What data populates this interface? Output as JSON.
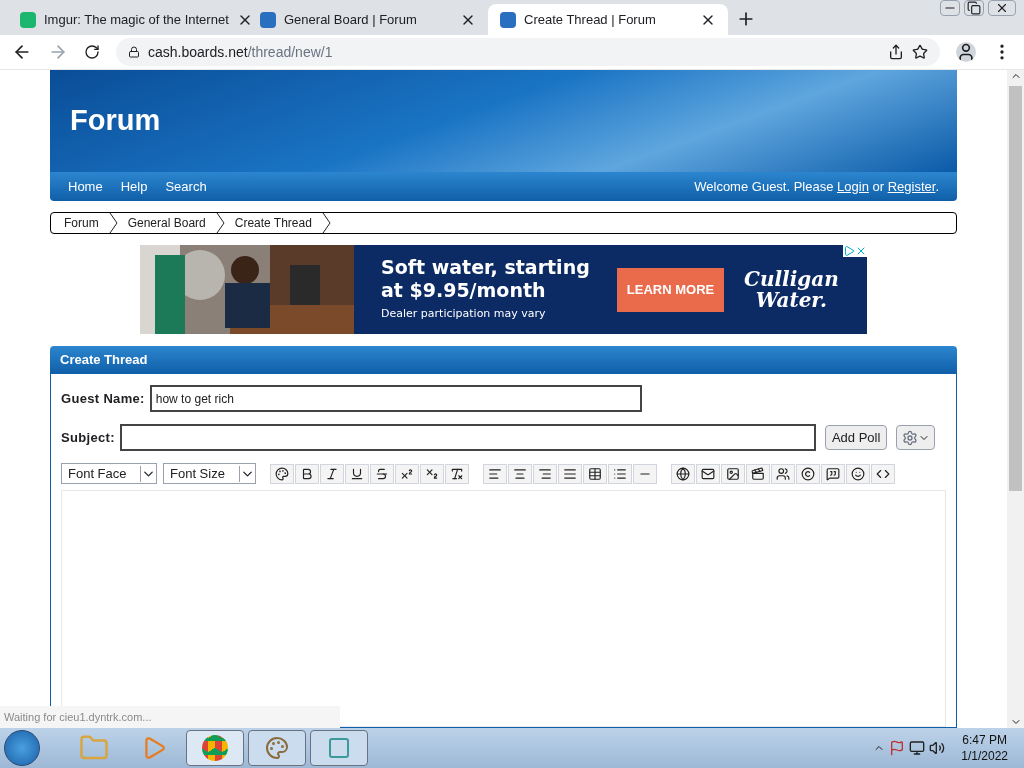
{
  "browser": {
    "tabs": [
      {
        "title": "Imgur: The magic of the Internet",
        "selected": false,
        "kind": "imgur"
      },
      {
        "title": "General Board | Forum",
        "selected": false,
        "kind": "pb"
      },
      {
        "title": "Create Thread | Forum",
        "selected": true,
        "kind": "pb"
      }
    ],
    "url_host": "cash.boards.net",
    "url_path": "/thread/new/1",
    "status": "Waiting for cieu1.dyntrk.com..."
  },
  "forum": {
    "title": "Forum",
    "nav": [
      "Home",
      "Help",
      "Search"
    ],
    "welcome": {
      "before": "Welcome Guest. Please ",
      "login": "Login",
      "middle": " or ",
      "register": "Register",
      "after": "."
    },
    "breadcrumbs": [
      "Forum",
      "General Board",
      "Create Thread"
    ]
  },
  "ad": {
    "headline": "Soft water, starting at $9.95/month",
    "subline": "Dealer participation may vary",
    "button": "LEARN MORE",
    "logo_line_1": "Culligan",
    "logo_line_2": "Water."
  },
  "panel": {
    "title": "Create Thread",
    "guest_label": "Guest Name:",
    "guest_value": "how to get rich",
    "subject_label": "Subject:",
    "add_poll": "Add Poll",
    "font_face": "Font Face",
    "font_size": "Font Size"
  },
  "taskbar": {
    "time": "6:47 PM",
    "date": "1/1/2022"
  }
}
